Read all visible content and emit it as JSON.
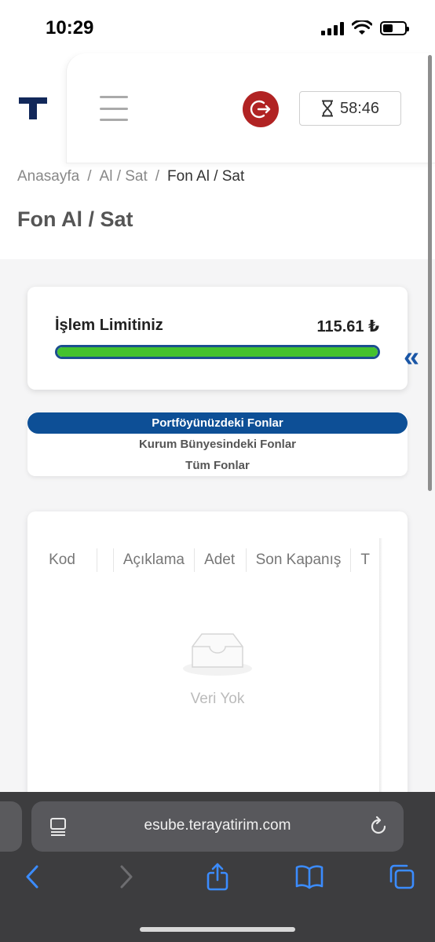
{
  "status_bar": {
    "time": "10:29"
  },
  "header": {
    "timer": "58:46",
    "breadcrumb": [
      "Anasayfa",
      "/",
      "Al / Sat",
      "/",
      "Fon Al / Sat"
    ],
    "page_title": "Fon Al / Sat"
  },
  "limit": {
    "label": "İşlem Limitiniz",
    "value": "115.61 ₺",
    "fill_fraction": 1.0
  },
  "tabs": [
    {
      "label": "Portföyünüzdeki Fonlar",
      "active": true
    },
    {
      "label": "Kurum Bünyesindeki Fonlar",
      "active": false
    },
    {
      "label": "Tüm Fonlar",
      "active": false
    }
  ],
  "table": {
    "columns": [
      "Kod",
      "",
      "Açıklama",
      "Adet",
      "Son Kapanış",
      "T"
    ],
    "empty_text": "Veri Yok"
  },
  "browser": {
    "url": "esube.terayatirim.com"
  },
  "colors": {
    "brand_navy": "#12285a",
    "tab_active": "#0d4f96",
    "progress_fill": "#44c22e",
    "logout_red": "#b12323"
  }
}
